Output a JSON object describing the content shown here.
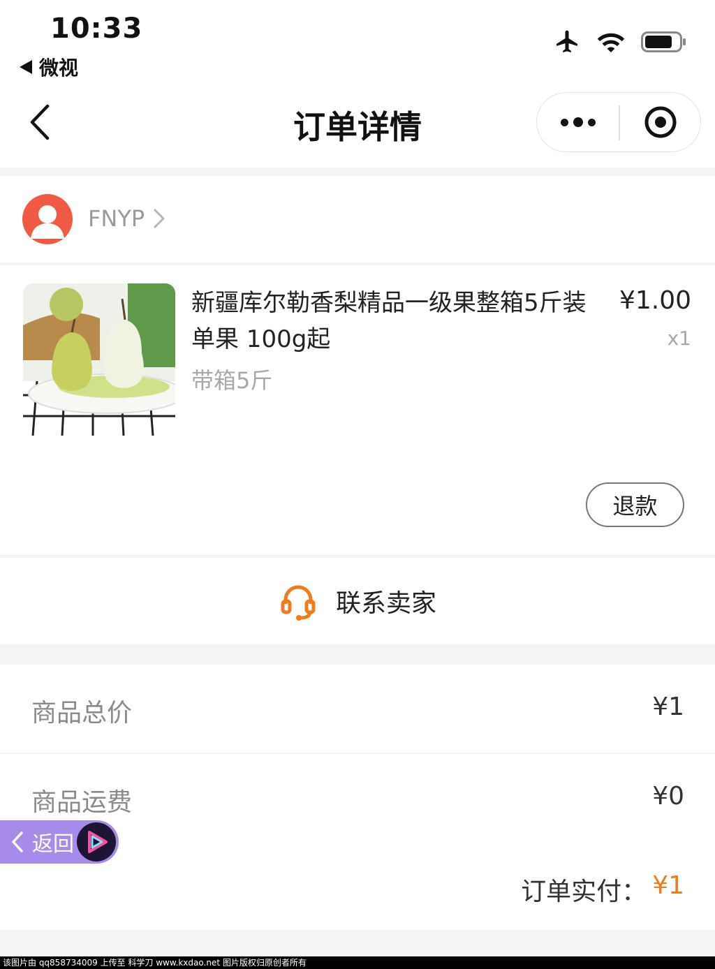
{
  "status_bar": {
    "time": "10:33",
    "back_app": "微视",
    "icons": [
      "airplane-icon",
      "wifi-icon",
      "battery-icon"
    ]
  },
  "nav": {
    "title": "订单详情",
    "capsule_icons": [
      "more-icon",
      "target-icon"
    ]
  },
  "store": {
    "name": "FNYP"
  },
  "product": {
    "title": "新疆库尔勒香梨精品一级果整箱5斤装单果 100g起",
    "sku": "带箱5斤",
    "price": "¥1.00",
    "quantity": "x1",
    "refund_label": "退款"
  },
  "contact": {
    "label": "联系卖家"
  },
  "summary": {
    "goods_total_label": "商品总价",
    "goods_total_value": "¥1",
    "shipping_label": "商品运费",
    "shipping_value": "¥0",
    "paid_label": "订单实付：",
    "paid_value": "¥1"
  },
  "float_back": {
    "label": "返回"
  },
  "footer": {
    "text": "该图片由 qq858734009 上传至 科学刀 www.kxdao.net 图片版权归原创者所有"
  },
  "colors": {
    "accent_orange": "#f07a1e",
    "avatar_red": "#f05a44",
    "float_purple": "#a78bea"
  }
}
